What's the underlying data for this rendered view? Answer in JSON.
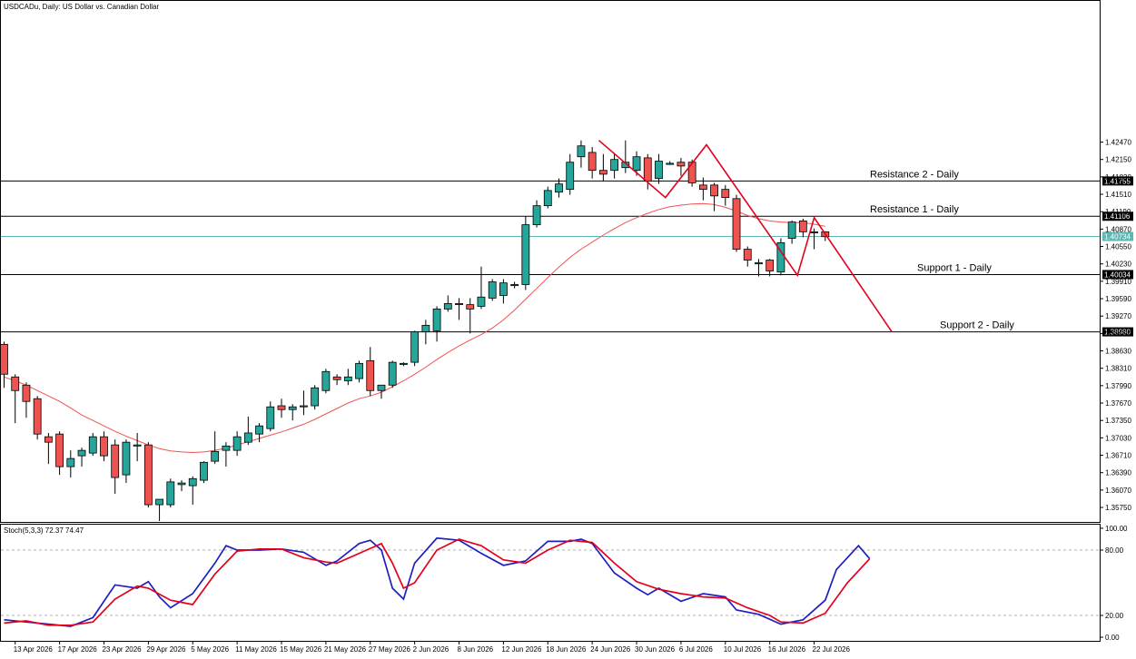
{
  "header": {
    "title": "USDCADu, Daily:  US Dollar vs. Canadian Dollar"
  },
  "colors": {
    "bull": "#26a69a",
    "bear": "#ef5350",
    "ma": "#ef5350",
    "trendline": "#e3001b",
    "stoch_main": "#1f1fbf",
    "stoch_signal": "#e3001b",
    "current_price_line": "#5fb7b3",
    "level_line": "#000000"
  },
  "chart_data": [
    {
      "type": "candlestick",
      "ylim": [
        1.3545,
        1.4495
      ],
      "y_ticks": [
        "1.42470",
        "1.42150",
        "1.41830",
        "1.41510",
        "1.41190",
        "1.40870",
        "1.40550",
        "1.40230",
        "1.39910",
        "1.39590",
        "1.39270",
        "1.38950",
        "1.38630",
        "1.38310",
        "1.37990",
        "1.37670",
        "1.37350",
        "1.37030",
        "1.36710",
        "1.36390",
        "1.36070",
        "1.35750"
      ],
      "x_tick_labels": [
        {
          "i": 1,
          "label": "13 Apr 2026"
        },
        {
          "i": 5,
          "label": "17 Apr 2026"
        },
        {
          "i": 9,
          "label": "23 Apr 2026"
        },
        {
          "i": 13,
          "label": "29 Apr 2026"
        },
        {
          "i": 17,
          "label": "5 May 2026"
        },
        {
          "i": 21,
          "label": "11 May 2026"
        },
        {
          "i": 25,
          "label": "15 May 2026"
        },
        {
          "i": 29,
          "label": "21 May 2026"
        },
        {
          "i": 33,
          "label": "27 May 2026"
        },
        {
          "i": 37,
          "label": "2 Jun 2026"
        },
        {
          "i": 41,
          "label": "8 Jun 2026"
        },
        {
          "i": 45,
          "label": "12 Jun 2026"
        },
        {
          "i": 49,
          "label": "18 Jun 2026"
        },
        {
          "i": 53,
          "label": "24 Jun 2026"
        },
        {
          "i": 57,
          "label": "30 Jun 2026"
        },
        {
          "i": 61,
          "label": "6 Jul 2026"
        },
        {
          "i": 65,
          "label": "10 Jul 2026"
        },
        {
          "i": 69,
          "label": "16 Jul 2026"
        },
        {
          "i": 73,
          "label": "22 Jul 2026"
        }
      ],
      "candles": [
        {
          "o": 1.3875,
          "h": 1.388,
          "l": 1.3795,
          "c": 1.382
        },
        {
          "o": 1.3815,
          "h": 1.382,
          "l": 1.373,
          "c": 1.379
        },
        {
          "o": 1.38,
          "h": 1.3805,
          "l": 1.374,
          "c": 1.377
        },
        {
          "o": 1.3775,
          "h": 1.378,
          "l": 1.37,
          "c": 1.371
        },
        {
          "o": 1.3705,
          "h": 1.3712,
          "l": 1.3655,
          "c": 1.3695
        },
        {
          "o": 1.371,
          "h": 1.3715,
          "l": 1.3635,
          "c": 1.365
        },
        {
          "o": 1.365,
          "h": 1.368,
          "l": 1.363,
          "c": 1.3665
        },
        {
          "o": 1.367,
          "h": 1.3685,
          "l": 1.365,
          "c": 1.368
        },
        {
          "o": 1.3675,
          "h": 1.3712,
          "l": 1.367,
          "c": 1.3705
        },
        {
          "o": 1.3705,
          "h": 1.3715,
          "l": 1.366,
          "c": 1.367
        },
        {
          "o": 1.369,
          "h": 1.37,
          "l": 1.36,
          "c": 1.363
        },
        {
          "o": 1.3635,
          "h": 1.37,
          "l": 1.362,
          "c": 1.3695
        },
        {
          "o": 1.369,
          "h": 1.3712,
          "l": 1.366,
          "c": 1.369
        },
        {
          "o": 1.369,
          "h": 1.3695,
          "l": 1.3575,
          "c": 1.358
        },
        {
          "o": 1.358,
          "h": 1.359,
          "l": 1.355,
          "c": 1.359
        },
        {
          "o": 1.358,
          "h": 1.3628,
          "l": 1.3575,
          "c": 1.3622
        },
        {
          "o": 1.3617,
          "h": 1.3625,
          "l": 1.3605,
          "c": 1.362
        },
        {
          "o": 1.3615,
          "h": 1.3632,
          "l": 1.358,
          "c": 1.3628
        },
        {
          "o": 1.3625,
          "h": 1.366,
          "l": 1.362,
          "c": 1.3658
        },
        {
          "o": 1.366,
          "h": 1.3715,
          "l": 1.3655,
          "c": 1.3678
        },
        {
          "o": 1.368,
          "h": 1.3695,
          "l": 1.365,
          "c": 1.3688
        },
        {
          "o": 1.368,
          "h": 1.3715,
          "l": 1.367,
          "c": 1.3705
        },
        {
          "o": 1.3695,
          "h": 1.3742,
          "l": 1.369,
          "c": 1.3712
        },
        {
          "o": 1.371,
          "h": 1.373,
          "l": 1.3695,
          "c": 1.3725
        },
        {
          "o": 1.372,
          "h": 1.377,
          "l": 1.3715,
          "c": 1.376
        },
        {
          "o": 1.3762,
          "h": 1.3775,
          "l": 1.374,
          "c": 1.3755
        },
        {
          "o": 1.3755,
          "h": 1.3765,
          "l": 1.3735,
          "c": 1.376
        },
        {
          "o": 1.376,
          "h": 1.379,
          "l": 1.3745,
          "c": 1.3762
        },
        {
          "o": 1.3762,
          "h": 1.38,
          "l": 1.3755,
          "c": 1.3795
        },
        {
          "o": 1.379,
          "h": 1.383,
          "l": 1.3785,
          "c": 1.3825
        },
        {
          "o": 1.3815,
          "h": 1.382,
          "l": 1.38,
          "c": 1.381
        },
        {
          "o": 1.3808,
          "h": 1.383,
          "l": 1.38,
          "c": 1.3815
        },
        {
          "o": 1.3812,
          "h": 1.3845,
          "l": 1.3805,
          "c": 1.384
        },
        {
          "o": 1.3845,
          "h": 1.387,
          "l": 1.378,
          "c": 1.379
        },
        {
          "o": 1.379,
          "h": 1.38,
          "l": 1.3775,
          "c": 1.38
        },
        {
          "o": 1.38,
          "h": 1.3845,
          "l": 1.3795,
          "c": 1.3842
        },
        {
          "o": 1.384,
          "h": 1.3842,
          "l": 1.3835,
          "c": 1.384
        },
        {
          "o": 1.3842,
          "h": 1.39,
          "l": 1.3835,
          "c": 1.3898
        },
        {
          "o": 1.3898,
          "h": 1.392,
          "l": 1.3875,
          "c": 1.391
        },
        {
          "o": 1.39,
          "h": 1.3945,
          "l": 1.388,
          "c": 1.394
        },
        {
          "o": 1.394,
          "h": 1.3965,
          "l": 1.3935,
          "c": 1.395
        },
        {
          "o": 1.395,
          "h": 1.396,
          "l": 1.392,
          "c": 1.3948
        },
        {
          "o": 1.3948,
          "h": 1.396,
          "l": 1.3895,
          "c": 1.394
        },
        {
          "o": 1.3945,
          "h": 1.4018,
          "l": 1.394,
          "c": 1.3962
        },
        {
          "o": 1.396,
          "h": 1.3995,
          "l": 1.3955,
          "c": 1.399
        },
        {
          "o": 1.3965,
          "h": 1.3995,
          "l": 1.395,
          "c": 1.3988
        },
        {
          "o": 1.3985,
          "h": 1.399,
          "l": 1.3978,
          "c": 1.3985
        },
        {
          "o": 1.3985,
          "h": 1.411,
          "l": 1.3975,
          "c": 1.4095
        },
        {
          "o": 1.4095,
          "h": 1.414,
          "l": 1.409,
          "c": 1.413
        },
        {
          "o": 1.413,
          "h": 1.4165,
          "l": 1.4125,
          "c": 1.4158
        },
        {
          "o": 1.4155,
          "h": 1.418,
          "l": 1.4145,
          "c": 1.417
        },
        {
          "o": 1.416,
          "h": 1.4225,
          "l": 1.415,
          "c": 1.421
        },
        {
          "o": 1.422,
          "h": 1.425,
          "l": 1.42,
          "c": 1.424
        },
        {
          "o": 1.4228,
          "h": 1.4238,
          "l": 1.418,
          "c": 1.4195
        },
        {
          "o": 1.4195,
          "h": 1.4225,
          "l": 1.4175,
          "c": 1.4188
        },
        {
          "o": 1.4195,
          "h": 1.4225,
          "l": 1.418,
          "c": 1.4215
        },
        {
          "o": 1.42,
          "h": 1.425,
          "l": 1.419,
          "c": 1.421
        },
        {
          "o": 1.4195,
          "h": 1.423,
          "l": 1.4185,
          "c": 1.422
        },
        {
          "o": 1.4218,
          "h": 1.4225,
          "l": 1.416,
          "c": 1.4175
        },
        {
          "o": 1.418,
          "h": 1.4225,
          "l": 1.417,
          "c": 1.4212
        },
        {
          "o": 1.4208,
          "h": 1.4212,
          "l": 1.4205,
          "c": 1.4208
        },
        {
          "o": 1.421,
          "h": 1.4218,
          "l": 1.4185,
          "c": 1.4203
        },
        {
          "o": 1.421,
          "h": 1.4215,
          "l": 1.4165,
          "c": 1.4172
        },
        {
          "o": 1.4168,
          "h": 1.4182,
          "l": 1.414,
          "c": 1.416
        },
        {
          "o": 1.4168,
          "h": 1.4172,
          "l": 1.412,
          "c": 1.4148
        },
        {
          "o": 1.416,
          "h": 1.4168,
          "l": 1.413,
          "c": 1.4145
        },
        {
          "o": 1.4143,
          "h": 1.415,
          "l": 1.4045,
          "c": 1.405
        },
        {
          "o": 1.405,
          "h": 1.4055,
          "l": 1.4018,
          "c": 1.403
        },
        {
          "o": 1.4025,
          "h": 1.4032,
          "l": 1.4,
          "c": 1.4025
        },
        {
          "o": 1.403,
          "h": 1.4032,
          "l": 1.4,
          "c": 1.401
        },
        {
          "o": 1.4008,
          "h": 1.407,
          "l": 1.4002,
          "c": 1.4062
        },
        {
          "o": 1.407,
          "h": 1.4103,
          "l": 1.406,
          "c": 1.41
        },
        {
          "o": 1.4102,
          "h": 1.4106,
          "l": 1.4072,
          "c": 1.4082
        },
        {
          "o": 1.4082,
          "h": 1.4088,
          "l": 1.405,
          "c": 1.408
        },
        {
          "o": 1.4082,
          "h": 1.4083,
          "l": 1.4065,
          "c": 1.4073
        }
      ],
      "ma": [
        1.3815,
        1.3808,
        1.38,
        1.379,
        1.378,
        1.377,
        1.3758,
        1.3745,
        1.3735,
        1.3725,
        1.3715,
        1.3706,
        1.3698,
        1.369,
        1.3683,
        1.3679,
        1.3677,
        1.3676,
        1.3677,
        1.368,
        1.3684,
        1.369,
        1.3696,
        1.3702,
        1.3708,
        1.3714,
        1.3721,
        1.3728,
        1.3737,
        1.3747,
        1.3757,
        1.3767,
        1.3775,
        1.378,
        1.3787,
        1.3797,
        1.3808,
        1.382,
        1.3833,
        1.3847,
        1.386,
        1.3872,
        1.3883,
        1.3893,
        1.3905,
        1.392,
        1.3938,
        1.3958,
        1.3978,
        1.3998,
        1.4017,
        1.4035,
        1.405,
        1.4063,
        1.4076,
        1.4088,
        1.4099,
        1.4108,
        1.4116,
        1.4123,
        1.4128,
        1.4131,
        1.4133,
        1.4134,
        1.4132,
        1.4127,
        1.412,
        1.4112,
        1.4106,
        1.4102,
        1.41,
        1.4099,
        1.4099,
        1.4096,
        1.4092
      ],
      "levels": [
        {
          "name": "Resistance 2 - Daily",
          "price": 1.41755,
          "price_text": "1.41755"
        },
        {
          "name": "Resistance 1 - Daily",
          "price": 1.41106,
          "price_text": "1.41106"
        },
        {
          "name": "",
          "price": 1.40734,
          "price_text": "1.40734",
          "current": true
        },
        {
          "name": "Support 1 - Daily",
          "price": 1.40034,
          "price_text": "1.40034"
        },
        {
          "name": "Support 2 - Daily",
          "price": 1.3898,
          "price_text": "1.38980"
        }
      ],
      "trendline": [
        {
          "i": 53.6,
          "p": 1.425
        },
        {
          "i": 59.6,
          "p": 1.4145
        },
        {
          "i": 63.3,
          "p": 1.4242
        },
        {
          "i": 71.5,
          "p": 1.4002
        },
        {
          "i": 73.0,
          "p": 1.4108
        },
        {
          "i": 80.0,
          "p": 1.3898
        }
      ]
    },
    {
      "type": "line",
      "title": "Stoch(5,3,3) 72.37 74.47",
      "ylim": [
        0,
        100
      ],
      "y_ticks": [
        "100.00",
        "80.00",
        "20.00",
        "0.00"
      ],
      "levels": [
        80,
        20
      ],
      "series": [
        {
          "name": "Main",
          "values": [
            [
              0,
              16
            ],
            [
              4,
              12
            ],
            [
              6,
              10
            ],
            [
              8,
              18
            ],
            [
              10,
              48
            ],
            [
              12,
              45
            ],
            [
              13,
              51
            ],
            [
              14,
              37
            ],
            [
              15,
              27
            ],
            [
              17,
              40
            ],
            [
              19,
              68
            ],
            [
              20,
              84
            ],
            [
              21,
              80
            ],
            [
              23,
              80
            ],
            [
              25,
              81
            ],
            [
              27,
              78
            ],
            [
              29,
              66
            ],
            [
              30,
              70
            ],
            [
              32,
              86
            ],
            [
              33,
              89
            ],
            [
              34,
              80
            ],
            [
              35,
              45
            ],
            [
              36,
              35
            ],
            [
              37,
              68
            ],
            [
              39,
              91
            ],
            [
              41,
              89
            ],
            [
              43,
              77
            ],
            [
              45,
              66
            ],
            [
              47,
              70
            ],
            [
              49,
              88
            ],
            [
              51,
              88
            ],
            [
              52,
              90
            ],
            [
              53,
              86
            ],
            [
              55,
              59
            ],
            [
              57,
              45
            ],
            [
              58,
              39
            ],
            [
              59,
              45
            ],
            [
              61,
              33
            ],
            [
              63,
              40
            ],
            [
              65,
              37
            ],
            [
              66,
              25
            ],
            [
              68,
              21
            ],
            [
              70,
              12
            ],
            [
              72,
              16
            ],
            [
              74,
              34
            ],
            [
              75,
              62
            ],
            [
              77,
              84
            ],
            [
              78,
              72
            ]
          ]
        },
        {
          "name": "Signal",
          "values": [
            [
              0,
              13
            ],
            [
              2,
              15
            ],
            [
              4,
              11
            ],
            [
              6,
              11
            ],
            [
              8,
              14
            ],
            [
              10,
              35
            ],
            [
              12,
              47
            ],
            [
              13,
              45
            ],
            [
              15,
              34
            ],
            [
              17,
              30
            ],
            [
              19,
              58
            ],
            [
              21,
              79
            ],
            [
              23,
              81
            ],
            [
              25,
              81
            ],
            [
              27,
              73
            ],
            [
              29,
              69
            ],
            [
              30,
              68
            ],
            [
              32,
              77
            ],
            [
              34,
              86
            ],
            [
              35,
              68
            ],
            [
              36,
              45
            ],
            [
              37,
              50
            ],
            [
              39,
              80
            ],
            [
              41,
              90
            ],
            [
              43,
              84
            ],
            [
              45,
              71
            ],
            [
              47,
              68
            ],
            [
              49,
              80
            ],
            [
              51,
              89
            ],
            [
              53,
              87
            ],
            [
              55,
              68
            ],
            [
              57,
              51
            ],
            [
              59,
              44
            ],
            [
              61,
              40
            ],
            [
              63,
              37
            ],
            [
              65,
              36
            ],
            [
              67,
              27
            ],
            [
              69,
              20
            ],
            [
              70,
              14
            ],
            [
              72,
              13
            ],
            [
              74,
              22
            ],
            [
              76,
              50
            ],
            [
              78,
              72
            ]
          ]
        }
      ]
    }
  ]
}
